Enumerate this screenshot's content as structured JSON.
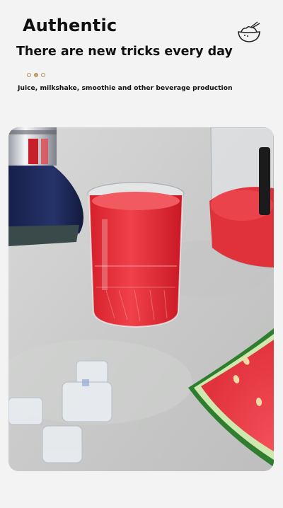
{
  "header": {
    "title": "Authentic",
    "subtitle": "There are new tricks every day",
    "caption": "Juice, milkshake, smoothie and other beverage production"
  },
  "icons": {
    "bowl": "rice-bowl-icon"
  },
  "colors": {
    "background": "#f3f3f3",
    "accent": "#c9a56e",
    "juice": "#e8323c",
    "blender_base": "#1f2a55"
  }
}
